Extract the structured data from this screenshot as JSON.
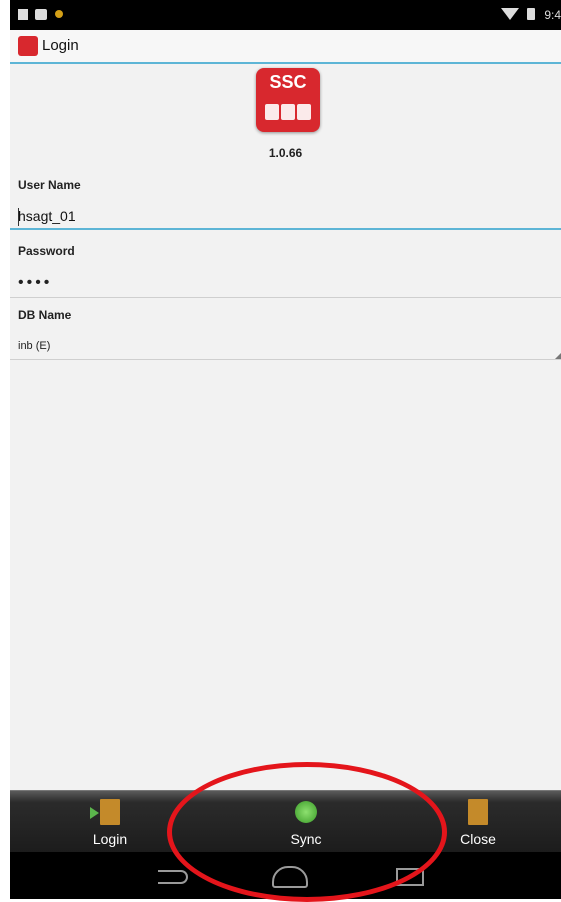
{
  "status_bar": {
    "time": "9:4"
  },
  "title_bar": {
    "title": "Login",
    "icon": "app-icon"
  },
  "logo": {
    "text": "SSC",
    "version": "1.0.66"
  },
  "form": {
    "user_name": {
      "label": "User Name",
      "value": "hsagt_01"
    },
    "password": {
      "label": "Password",
      "value": "••••"
    },
    "db_name": {
      "label": "DB Name",
      "value": "inb (E)"
    }
  },
  "bottom_bar": {
    "items": [
      {
        "label": "Login",
        "icon": "login-door-icon"
      },
      {
        "label": "Sync",
        "icon": "sync-icon"
      },
      {
        "label": "Close",
        "icon": "close-door-icon"
      }
    ]
  },
  "colors": {
    "accent": "#5db5d6",
    "brand": "#d8282e",
    "annotation": "#e4151b"
  }
}
